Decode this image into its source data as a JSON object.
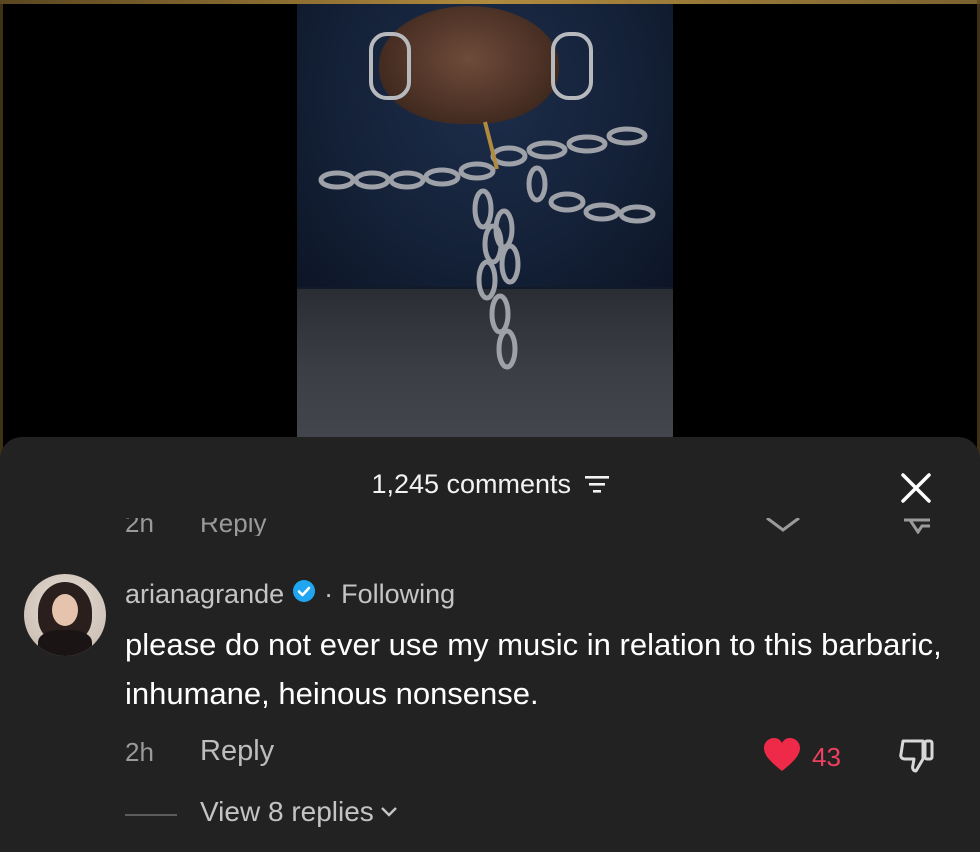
{
  "video": {
    "description_icon": "video-frame"
  },
  "comments_sheet": {
    "title": "1,245 comments",
    "filter_icon": "filter-icon",
    "close_icon": "close-icon",
    "previous_comment": {
      "time_fragment": "2h",
      "reply_fragment": "Reply"
    },
    "comment": {
      "username": "arianagrande",
      "separator": "·",
      "follow_status": "Following",
      "text": "please do not ever use my music in relation to this barbaric, inhumane, heinous nonsense.",
      "time": "2h",
      "reply_label": "Reply",
      "like_count": "43",
      "view_replies_label": "View 8 replies"
    }
  },
  "colors": {
    "sheet_background": "#222223",
    "like_color": "#ee4060",
    "verified_color": "#20a5f0"
  }
}
